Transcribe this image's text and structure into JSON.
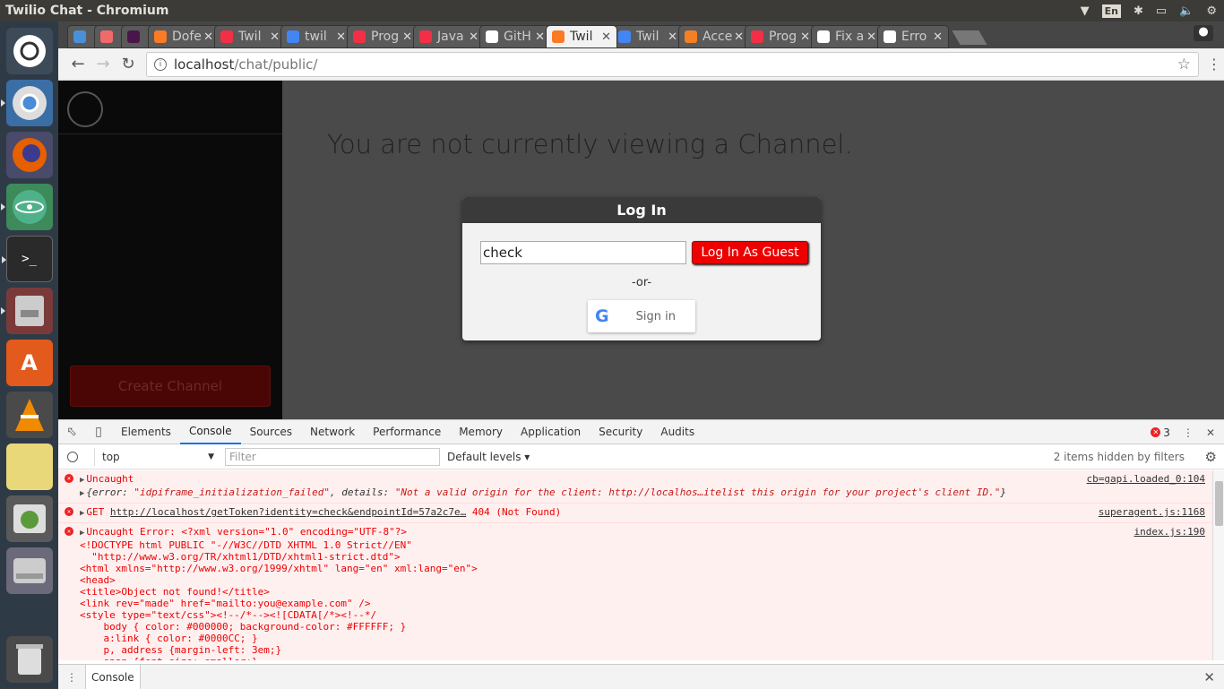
{
  "window": {
    "title": "Twilio Chat - Chromium"
  },
  "system": {
    "lang": "En"
  },
  "tabs": [
    {
      "label": "",
      "color": "#4a90d9",
      "active": false
    },
    {
      "label": "",
      "color": "#f06a6a",
      "active": false
    },
    {
      "label": "",
      "color": "#4a154b",
      "active": false
    },
    {
      "label": "Dofe",
      "color": "#fb7a24",
      "active": false
    },
    {
      "label": "Twil",
      "color": "#f22f46",
      "active": false
    },
    {
      "label": "twil",
      "color": "#4285f4",
      "active": false
    },
    {
      "label": "Prog",
      "color": "#f22f46",
      "active": false
    },
    {
      "label": "Java",
      "color": "#f22f46",
      "active": false
    },
    {
      "label": "GitH",
      "color": "#ffffff",
      "active": false
    },
    {
      "label": "Twil",
      "color": "#fb7a24",
      "active": true
    },
    {
      "label": "Twil",
      "color": "#4285f4",
      "active": false
    },
    {
      "label": "Acce",
      "color": "#f48024",
      "active": false
    },
    {
      "label": "Prog",
      "color": "#f22f46",
      "active": false
    },
    {
      "label": "Fix a",
      "color": "#ffffff",
      "active": false
    },
    {
      "label": "Erro",
      "color": "#ffffff",
      "active": false
    }
  ],
  "address": {
    "host": "localhost",
    "path": "/chat/public/"
  },
  "app": {
    "create_channel": "Create Channel",
    "no_channel_msg": "You are not currently viewing a Channel.",
    "login": {
      "title": "Log In",
      "username_value": "check",
      "guest_button": "Log In As Guest",
      "or": "-or-",
      "google_signin": "Sign in",
      "google_g": "G"
    }
  },
  "devtools": {
    "tabs": [
      "Elements",
      "Console",
      "Sources",
      "Network",
      "Performance",
      "Memory",
      "Application",
      "Security",
      "Audits"
    ],
    "active_tab": "Console",
    "error_count": "3",
    "context": "top",
    "filter_placeholder": "Filter",
    "levels": "Default levels",
    "hidden_note": "2 items hidden by filters",
    "drawer_tab": "Console",
    "messages": {
      "m1_title": "Uncaught",
      "m1_src": "cb=gapi.loaded_0:104",
      "m1_obj_prefix": "{error: ",
      "m1_error": "\"idpiframe_initialization_failed\"",
      "m1_mid": ", details: ",
      "m1_details": "\"Not a valid origin for the client: http://localhos…itelist this origin for your project's client ID.\"",
      "m1_suffix": "}",
      "m2_method": "GET ",
      "m2_url": "http://localhost/getToken?identity=check&endpointId=57a2c7e…",
      "m2_status": " 404 (Not Found)",
      "m2_src": "superagent.js:1168",
      "m3_title": "Uncaught Error: <?xml version=\"1.0\" encoding=\"UTF-8\"?>",
      "m3_src": "index.js:190",
      "m3_body": "<!DOCTYPE html PUBLIC \"-//W3C//DTD XHTML 1.0 Strict//EN\"\n  \"http://www.w3.org/TR/xhtml1/DTD/xhtml1-strict.dtd\">\n<html xmlns=\"http://www.w3.org/1999/xhtml\" lang=\"en\" xml:lang=\"en\">\n<head>\n<title>Object not found!</title>\n<link rev=\"made\" href=\"mailto:you@example.com\" />\n<style type=\"text/css\"><!--/*--><![CDATA[/*><!--*/\n    body { color: #000000; background-color: #FFFFFF; }\n    a:link { color: #0000CC; }\n    p, address {margin-left: 3em;}\n    span {font-size: smaller;}"
    }
  }
}
